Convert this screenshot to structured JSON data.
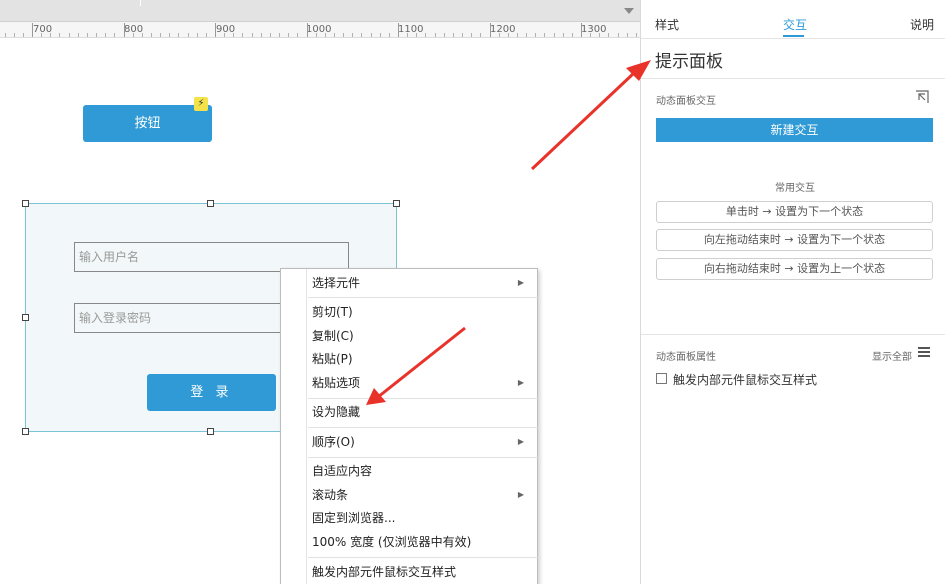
{
  "ruler": {
    "labels": [
      "700",
      "800",
      "900",
      "1000",
      "1100",
      "1200",
      "1300"
    ]
  },
  "canvas": {
    "button_label": "按钮",
    "lightning_glyph": "⚡",
    "username_placeholder": "输入用户名",
    "password_placeholder": "输入登录密码",
    "login_label": "登 录"
  },
  "context_menu": {
    "items": [
      {
        "label": "选择元件",
        "submenu": true
      },
      {
        "label": "剪切(T)",
        "submenu": false
      },
      {
        "label": "复制(C)",
        "submenu": false
      },
      {
        "label": "粘贴(P)",
        "submenu": false
      },
      {
        "label": "粘贴选项",
        "submenu": true
      },
      {
        "label": "设为隐藏",
        "submenu": false
      },
      {
        "label": "顺序(O)",
        "submenu": true
      },
      {
        "label": "自适应内容",
        "submenu": false
      },
      {
        "label": "滚动条",
        "submenu": true
      },
      {
        "label": "固定到浏览器...",
        "submenu": false
      },
      {
        "label": "100% 宽度 (仅浏览器中有效)",
        "submenu": false
      },
      {
        "label": "触发内部元件鼠标交互样式",
        "submenu": false
      }
    ]
  },
  "right_panel": {
    "tabs": {
      "style": "样式",
      "interaction": "交互",
      "notes": "说明"
    },
    "title": "提示面板",
    "section_dynamic_interaction": "动态面板交互",
    "new_interaction_label": "新建交互",
    "common_interactions_header": "常用交互",
    "quick_actions": [
      "单击时 → 设置为下一个状态",
      "向左拖动结束时 → 设置为下一个状态",
      "向右拖动结束时 → 设置为上一个状态"
    ],
    "properties_header": "动态面板属性",
    "show_all_label": "显示全部",
    "checkbox_label": "触发内部元件鼠标交互样式",
    "checkbox_checked": false
  },
  "colors": {
    "accent": "#2f9ad5",
    "annotation_arrow": "#e8322a"
  }
}
